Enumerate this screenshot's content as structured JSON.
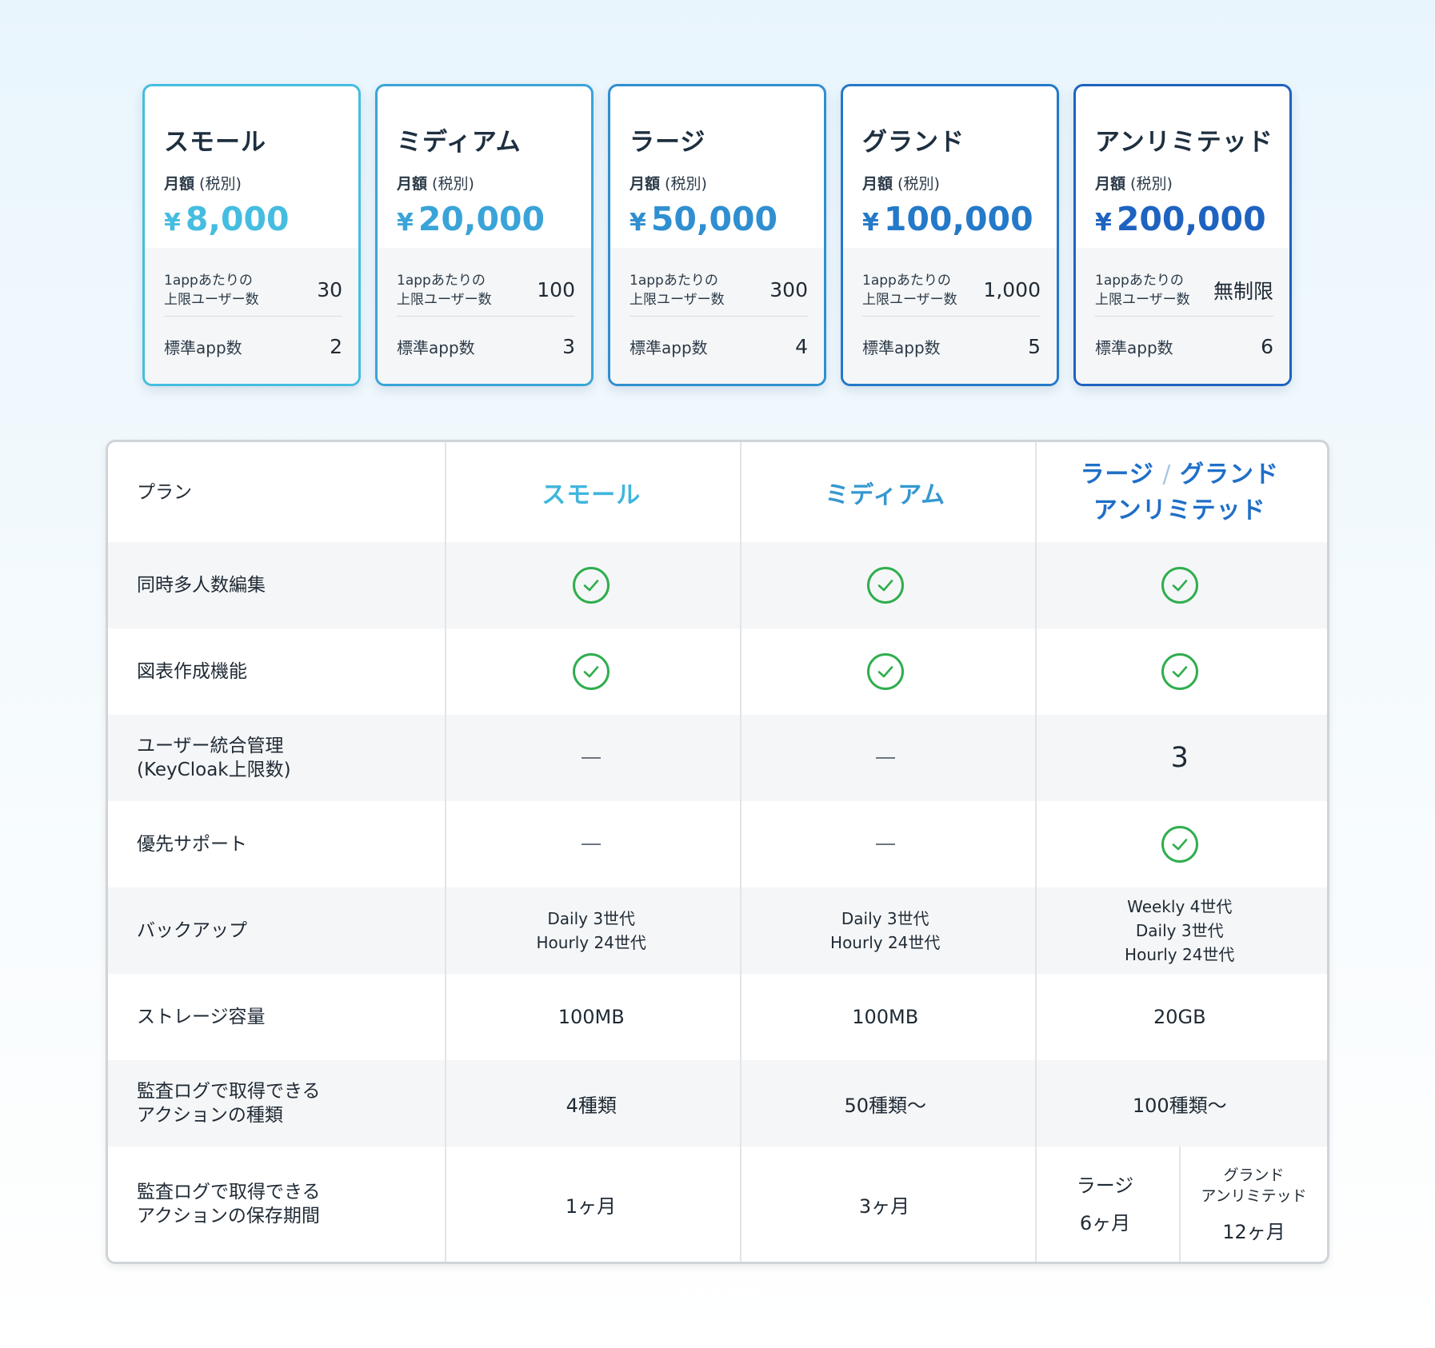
{
  "plans": [
    {
      "name": "スモール",
      "period_bold": "月額",
      "period_note": " (税別)",
      "currency": "¥",
      "price": "8,000",
      "users_label_1": "1appあたりの",
      "users_label_2": "上限ユーザー数",
      "users_value": "30",
      "apps_label": "標準app数",
      "apps_value": "2",
      "accent": "#45bde0"
    },
    {
      "name": "ミディアム",
      "period_bold": "月額",
      "period_note": " (税別)",
      "currency": "¥",
      "price": "20,000",
      "users_label_1": "1appあたりの",
      "users_label_2": "上限ユーザー数",
      "users_value": "100",
      "apps_label": "標準app数",
      "apps_value": "3",
      "accent": "#3aa4d8"
    },
    {
      "name": "ラージ",
      "period_bold": "月額",
      "period_note": " (税別)",
      "currency": "¥",
      "price": "50,000",
      "users_label_1": "1appあたりの",
      "users_label_2": "上限ユーザー数",
      "users_value": "300",
      "apps_label": "標準app数",
      "apps_value": "4",
      "accent": "#2f8fd0"
    },
    {
      "name": "グランド",
      "period_bold": "月額",
      "period_note": " (税別)",
      "currency": "¥",
      "price": "100,000",
      "users_label_1": "1appあたりの",
      "users_label_2": "上限ユーザー数",
      "users_value": "1,000",
      "apps_label": "標準app数",
      "apps_value": "5",
      "accent": "#2479c8"
    },
    {
      "name": "アンリミテッド",
      "period_bold": "月額",
      "period_note": " (税別)",
      "currency": "¥",
      "price": "200,000",
      "users_label_1": "1appあたりの",
      "users_label_2": "上限ユーザー数",
      "users_value": "無制限",
      "apps_label": "標準app数",
      "apps_value": "6",
      "accent": "#1e63c0"
    }
  ],
  "table": {
    "header": {
      "label": "プラン",
      "small": "スモール",
      "medium": "ミディアム",
      "large_line1_a": "ラージ",
      "large_line1_sep": " / ",
      "large_line1_b": "グランド",
      "large_line2": "アンリミテッド"
    },
    "rows": {
      "editing": {
        "label": "同時多人数編集",
        "small": "check",
        "medium": "check",
        "large": "check"
      },
      "charts": {
        "label": "図表作成機能",
        "small": "check",
        "medium": "check",
        "large": "check"
      },
      "user_mgmt": {
        "label_1": "ユーザー統合管理",
        "label_2": "(KeyCloak上限数)",
        "small": "dash",
        "medium": "dash",
        "large": "3"
      },
      "support": {
        "label": "優先サポート",
        "small": "dash",
        "medium": "dash",
        "large": "check"
      },
      "backup": {
        "label": "バックアップ",
        "small": [
          "Daily 3世代",
          "Hourly 24世代"
        ],
        "medium": [
          "Daily 3世代",
          "Hourly 24世代"
        ],
        "large": [
          "Weekly 4世代",
          "Daily 3世代",
          "Hourly 24世代"
        ]
      },
      "storage": {
        "label": "ストレージ容量",
        "small": "100MB",
        "medium": "100MB",
        "large": "20GB"
      },
      "audit_types": {
        "label_1": "監査ログで取得できる",
        "label_2": "アクションの種類",
        "small": "4種類",
        "medium": "50種類〜",
        "large": "100種類〜"
      },
      "audit_retention": {
        "label_1": "監査ログで取得できる",
        "label_2": "アクションの保存期間",
        "small": "1ヶ月",
        "medium": "3ヶ月",
        "large_a_title": "ラージ",
        "large_a_value": "6ヶ月",
        "large_b_title_1": "グランド",
        "large_b_title_2": "アンリミテッド",
        "large_b_value": "12ヶ月"
      }
    }
  },
  "colors": {
    "check": "#2fae4e",
    "dash": "#6d7680",
    "table_border": "#d0d4d8",
    "row_alt": "#f5f6f7"
  },
  "icons": {
    "check": "check-circle-icon",
    "dash": "dash-icon"
  }
}
